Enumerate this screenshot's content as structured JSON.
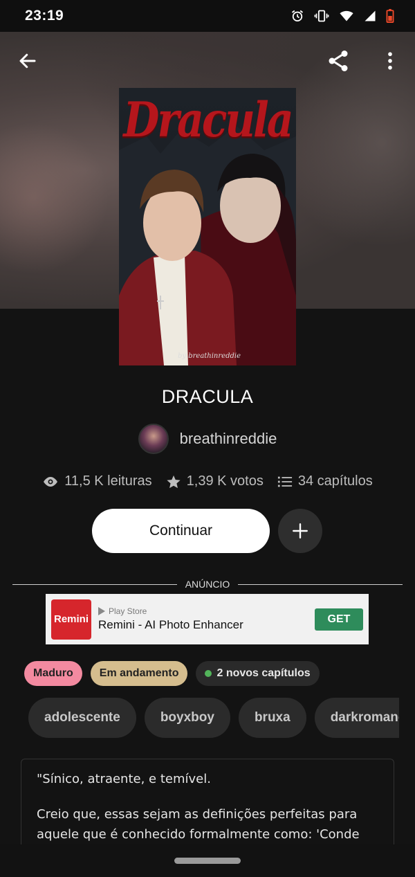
{
  "status_bar": {
    "time": "23:19",
    "icons": [
      "alarm-icon",
      "vibrate-icon",
      "wifi-icon",
      "signal-icon",
      "battery-low-icon"
    ]
  },
  "top_bar": {
    "back_icon": "arrow-left-icon",
    "share_icon": "share-icon",
    "menu_icon": "more-vertical-icon"
  },
  "cover": {
    "title_art": "Dracula",
    "byline": "by breathinreddie"
  },
  "story": {
    "title": "DRACULA",
    "author": "breathinreddie"
  },
  "stats": {
    "reads": "11,5 K leituras",
    "votes": "1,39 K votos",
    "chapters": "34 capítulos"
  },
  "actions": {
    "continue_label": "Continuar",
    "add_icon": "plus-icon"
  },
  "ad": {
    "label": "ANÚNCIO",
    "store": "Play Store",
    "app_name": "Remini - AI Photo Enhancer",
    "logo_text": "Remini",
    "cta": "GET"
  },
  "badges": {
    "mature": "Maduro",
    "status": "Em andamento",
    "new_chapters": "2 novos capítulos"
  },
  "tags": [
    "adolescente",
    "boyxboy",
    "bruxa",
    "darkromance"
  ],
  "description": {
    "line1": "\"Sínico, atraente, e temível.",
    "line2": "Creio que, essas sejam as definições perfeitas para aquele que é conhecido formalmente como: 'Conde"
  },
  "colors": {
    "mature": "#f38aa0",
    "in_progress": "#d5bd8e",
    "new_dot": "#52b45a",
    "ad_cta": "#2e8c5b",
    "ad_logo": "#d6262c"
  }
}
